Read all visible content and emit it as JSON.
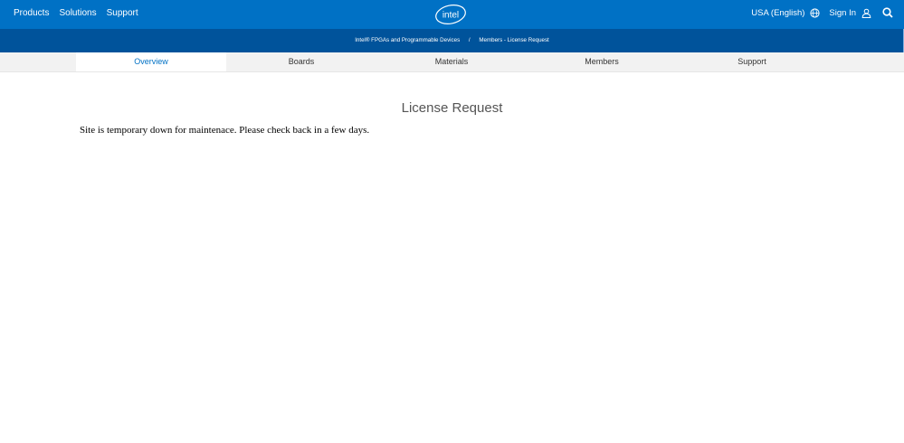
{
  "header": {
    "nav": [
      "Products",
      "Solutions",
      "Support"
    ],
    "logo_text": "intel",
    "locale": "USA (English)",
    "sign_in": "Sign In",
    "icons": [
      "globe-icon",
      "user-icon",
      "search-icon"
    ]
  },
  "breadcrumb": {
    "items": [
      "Intel® FPGAs and Programmable Devices",
      "Members - License Request"
    ],
    "separator": "/"
  },
  "tabs": [
    "Overview",
    "Boards",
    "Materials",
    "Members",
    "Support"
  ],
  "active_tab": "Overview",
  "page": {
    "title": "License Request",
    "message": "Site is temporary down for maintenace. Please check back in a few days."
  },
  "colors": {
    "brand_blue": "#0071c5",
    "dark_blue": "#00539b",
    "tab_bar": "#f2f2f2"
  }
}
